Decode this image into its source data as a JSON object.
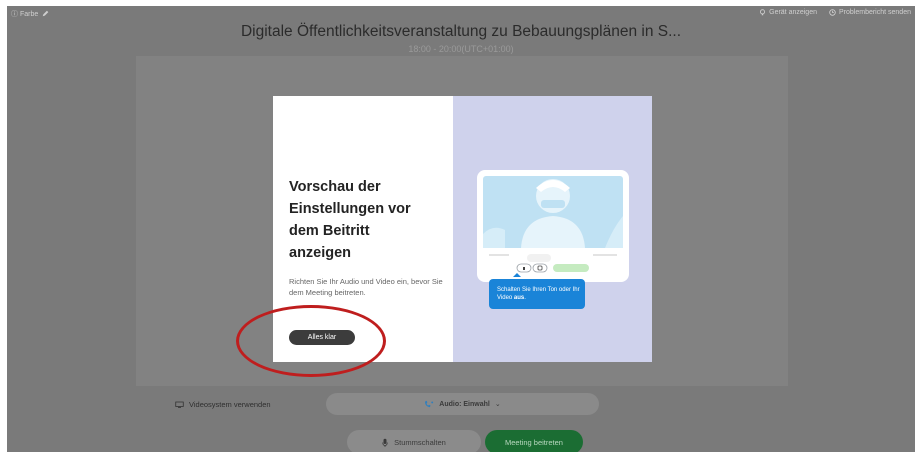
{
  "topbar": {
    "left_label": "ⓘ Farbe",
    "edit_icon": "pencil-icon",
    "right_items": [
      {
        "icon": "lightbulb-icon",
        "label": "Gerät anzeigen"
      },
      {
        "icon": "clock-icon",
        "label": "Problembericht senden"
      }
    ]
  },
  "meeting": {
    "title": "Digitale Öffentlichkeitsveranstaltung zu Bebauungsplänen in S...",
    "time": "18:00 - 20:00(UTC+01:00)"
  },
  "modal": {
    "heading": "Vorschau der Einstellungen vor dem Beitritt anzeigen",
    "body": "Richten Sie Ihr Audio und Video ein, bevor Sie dem Meeting beitreten.",
    "ok_label": "Alles klar",
    "tooltip_text": "Schalten Sie Ihren Ton oder Ihr Video ",
    "tooltip_bold": "aus",
    "tooltip_suffix": "."
  },
  "controls": {
    "virtual_bg_label": "Videosystem verwenden",
    "audio_label": "Audio: Einwahl",
    "audio_chevron": "⌄",
    "mute_label": "Stummschalten",
    "join_label": "Meeting beitreten"
  },
  "colors": {
    "overlay": "#7a7a7a",
    "join_green": "#1b6d33",
    "tooltip_blue": "#1a84d8",
    "illustration_bg": "#cfd2ec",
    "highlight_red": "#bf1e1e"
  }
}
